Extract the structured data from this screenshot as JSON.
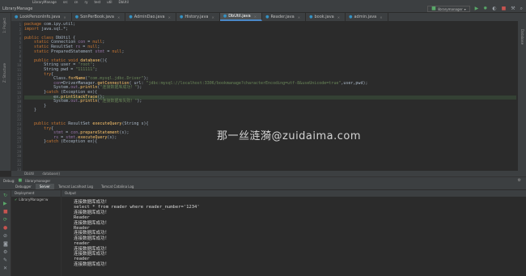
{
  "menu": [
    "LibraryManage",
    "src",
    "cn",
    "ry",
    "test",
    "util",
    "DbUtil"
  ],
  "nav": {
    "path": "LibraryManage",
    "run_config": "librarymanager"
  },
  "tabs": [
    {
      "label": "LookPersonInfo.java"
    },
    {
      "label": "SonPerBook.java"
    },
    {
      "label": "AdminDao.java"
    },
    {
      "label": "History.java"
    },
    {
      "label": "DbUtil.java",
      "active": true
    },
    {
      "label": "Reader.java"
    },
    {
      "label": "book.java"
    },
    {
      "label": "admin.java"
    }
  ],
  "gutter": [
    "1",
    "2",
    "3",
    "4",
    "5",
    "6",
    "7",
    "8",
    "9",
    "10",
    "11",
    "12",
    "13",
    "14",
    "15",
    "16",
    "17",
    "18",
    "19",
    "20",
    "21",
    "22",
    "23",
    "24",
    "25",
    "26",
    "27",
    "28",
    "29",
    "30",
    "31",
    "32",
    "33"
  ],
  "code": [
    "package com.ipy.util;",
    "import java.sql.*;",
    "",
    "public class DbUtil {",
    "    static Connection con = null;",
    "    static ResultSet rs = null;",
    "    static PreparedStatement stmt = null;",
    "",
    "    public static void database(){",
    "        String user = \"root\";",
    "        String pwd = \"111111\";",
    "        try{",
    "            Class.forName(\"com.mysql.jdbc.Driver\");",
    "            con=DriverManager.getConnection( url: \"jdbc:mysql://localhost:3306/bookmanage?characterEncoding=utf-8&useUnicode=true\",user,pwd);",
    "            System.out.println(\"连接数据库成功！\");",
    "        }catch (Exception ex){",
    "            ex.printStackTrace();",
    "            System.out.println(\"连接数据库失败！\");",
    "        }",
    "    }",
    "",
    "",
    "    public static ResultSet executeQuery(String s){",
    "        try{",
    "            stmt = con.prepareStatement(s);",
    "            rs = stmt.executeQuery(s);",
    "        }catch (Exception ex){"
  ],
  "watermark": "那一丝涟漪@zuidaima.com",
  "breadcrumb": [
    "DbUtil",
    "database()"
  ],
  "debug": {
    "title": "Debug:",
    "config": "librarymanager",
    "tabs": [
      "Debugger",
      "Server",
      "Tomcat Localhost Log",
      "Tomcat Catalina Log"
    ],
    "deployment_header": "Deployment",
    "deployment_item": "LibraryManager:w",
    "output_header": "Output"
  },
  "console": [
    "连接数据库成功！",
    "select * from reader where reader_number='1234'",
    "连接数据库成功！",
    "Reader",
    "连接数据库成功！",
    "Reader",
    "连接数据库成功！",
    "连接数据库成功！",
    "reader",
    "连接数据库成功！",
    "连接数据库成功！",
    "reader",
    "连接数据库成功！"
  ]
}
